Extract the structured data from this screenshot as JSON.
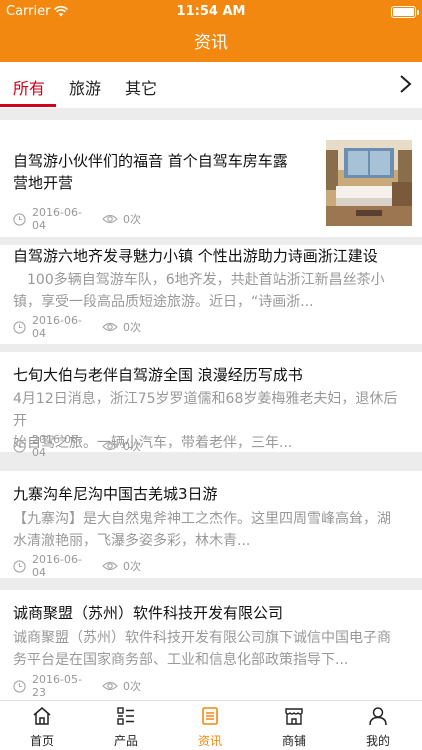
{
  "status_bar": {
    "carrier": "Carrier",
    "time": "11:54 AM"
  },
  "nav": {
    "title": "资讯"
  },
  "tabs": [
    {
      "label": "所有",
      "active": true
    },
    {
      "label": "旅游",
      "active": false
    },
    {
      "label": "其它",
      "active": false
    }
  ],
  "articles": [
    {
      "title_line1": "自驾游小伙伴们的福音 首个自驾车房车露",
      "title_line2": "营地开营",
      "summary_line1": "",
      "summary_line2": "",
      "date": "2016-06-04",
      "views": "0次",
      "has_image": true
    },
    {
      "title_line1": "自驾游六地齐发寻魅力小镇 个性出游助力诗画浙江建设",
      "title_line2": "",
      "summary_line1": "　100多辆自驾游车队，6地齐发，共赴首站浙江新昌丝茶小",
      "summary_line2": "镇，享受一段高品质短途旅游。近日，“诗画浙...",
      "date": "2016-06-04",
      "views": "0次",
      "has_image": false
    },
    {
      "title_line1": "七旬大伯与老伴自驾游全国 浪漫经历写成书",
      "title_line2": "",
      "summary_line1": "4月12日消息，浙江75岁罗道儒和68岁姜梅雅老夫妇，退休后开",
      "summary_line2": "始自驾之旅。一辆小汽车，带着老伴，三年...",
      "date": "2016-06-04",
      "views": "0次",
      "has_image": false
    },
    {
      "title_line1": "九寨沟牟尼沟中国古羌城3日游",
      "title_line2": "",
      "summary_line1": "【九寨沟】是大自然鬼斧神工之杰作。这里四周雪峰高耸，湖",
      "summary_line2": "水清澈艳丽，飞瀑多姿多彩，林木青...",
      "date": "2016-06-04",
      "views": "0次",
      "has_image": false
    },
    {
      "title_line1": "诚商聚盟（苏州）软件科技开发有限公司",
      "title_line2": "",
      "summary_line1": "诚商聚盟（苏州）软件科技开发有限公司旗下诚信中国电子商",
      "summary_line2": "务平台是在国家商务部、工业和信息化部政策指导下...",
      "date": "2016-05-23",
      "views": "0次",
      "has_image": false
    }
  ],
  "tab_bar": [
    {
      "label": "首页",
      "icon": "home-icon",
      "active": false
    },
    {
      "label": "产品",
      "icon": "list-icon",
      "active": false
    },
    {
      "label": "资讯",
      "icon": "news-icon",
      "active": true
    },
    {
      "label": "商铺",
      "icon": "shop-icon",
      "active": false
    },
    {
      "label": "我的",
      "icon": "user-icon",
      "active": false
    }
  ],
  "colors": {
    "accent": "#f2880f",
    "active_tab": "#d0021b"
  }
}
